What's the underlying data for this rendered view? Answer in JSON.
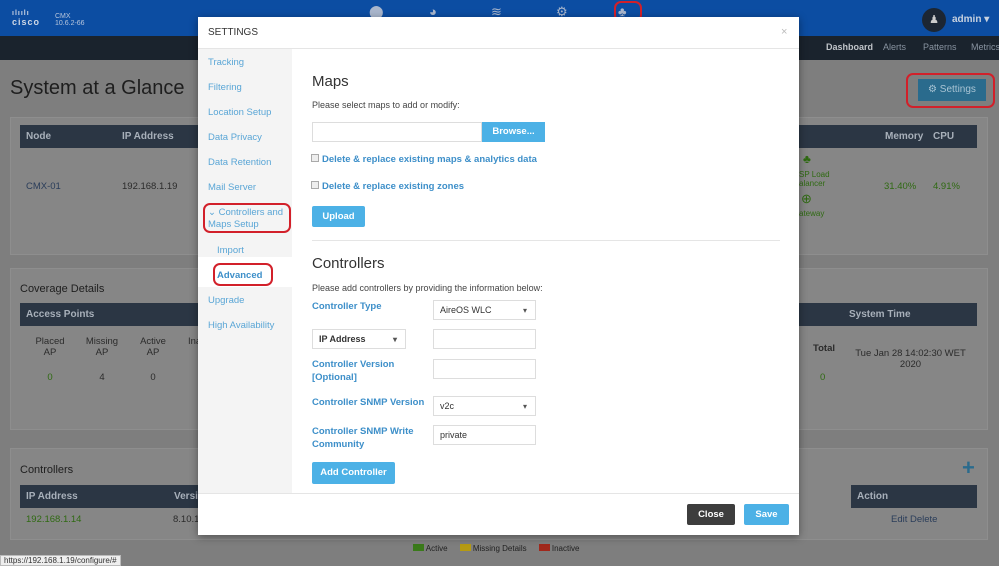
{
  "header": {
    "brand": "cisco",
    "product": "CMX",
    "version": "10.6.2-66",
    "user": "admin",
    "icons": [
      "location-pin-icon",
      "dashboard-gauge-icon",
      "wifi-icon",
      "gears-icon",
      "network-hierarchy-icon"
    ]
  },
  "nav": [
    "Dashboard",
    "Alerts",
    "Patterns",
    "Metrics"
  ],
  "page": {
    "title": "System at a Glance",
    "settings_button": "⚙ Settings"
  },
  "nodes": {
    "headers": [
      "Node",
      "IP Address",
      "Memory",
      "CPU"
    ],
    "row": {
      "node": "CMX-01",
      "ip": "192.168.1.19",
      "service1": "SP Load\nalancer",
      "service2": "ateway",
      "memory": "31.40%",
      "cpu": "4.91%"
    }
  },
  "coverage": {
    "title": "Coverage Details",
    "ap_header": "Access Points",
    "cols": [
      {
        "label": "Placed AP",
        "value": "0"
      },
      {
        "label": "Missing AP",
        "value": "4"
      },
      {
        "label": "Active AP",
        "value": "0"
      },
      {
        "label": "Ina",
        "value": ""
      }
    ],
    "total_label": "Total",
    "total_value": "0",
    "time_header": "System Time",
    "time": "Tue Jan 28 14:02:30 WET 2020"
  },
  "controllers": {
    "title": "Controllers",
    "headers": [
      "IP Address",
      "Versio",
      "Action"
    ],
    "row": {
      "ip": "192.168.1.14",
      "version": "8.10.1",
      "action": "Edit Delete"
    }
  },
  "legend": [
    {
      "label": "Active",
      "color": "#3a7a1a"
    },
    {
      "label": "Missing Details",
      "color": "#b59a12"
    },
    {
      "label": "Inactive",
      "color": "#a0281c"
    }
  ],
  "status_url": "https://192.168.1.19/configure/#",
  "modal": {
    "title": "SETTINGS",
    "close": "×",
    "sidebar": [
      "Tracking",
      "Filtering",
      "Location Setup",
      "Data Privacy",
      "Data Retention",
      "Mail Server",
      "Controllers and Maps Setup",
      "Import",
      "Advanced",
      "Upgrade",
      "High Availability"
    ],
    "maps": {
      "heading": "Maps",
      "desc": "Please select maps to add or modify:",
      "file_value": "",
      "browse": "Browse...",
      "check1": "Delete & replace existing maps & analytics data",
      "check2": "Delete & replace existing zones",
      "upload": "Upload"
    },
    "ctrl": {
      "heading": "Controllers",
      "desc": "Please add controllers by providing the information below:",
      "type_label": "Controller Type",
      "type_value": "AireOS WLC",
      "ip_select": "IP Address",
      "ip_value": "",
      "version_label": "Controller Version [Optional]",
      "version_value": "",
      "snmp_label": "Controller SNMP Version",
      "snmp_value": "v2c",
      "community_label": "Controller SNMP Write Community",
      "community_value": "private",
      "add": "Add Controller"
    },
    "footer": {
      "close": "Close",
      "save": "Save"
    }
  }
}
